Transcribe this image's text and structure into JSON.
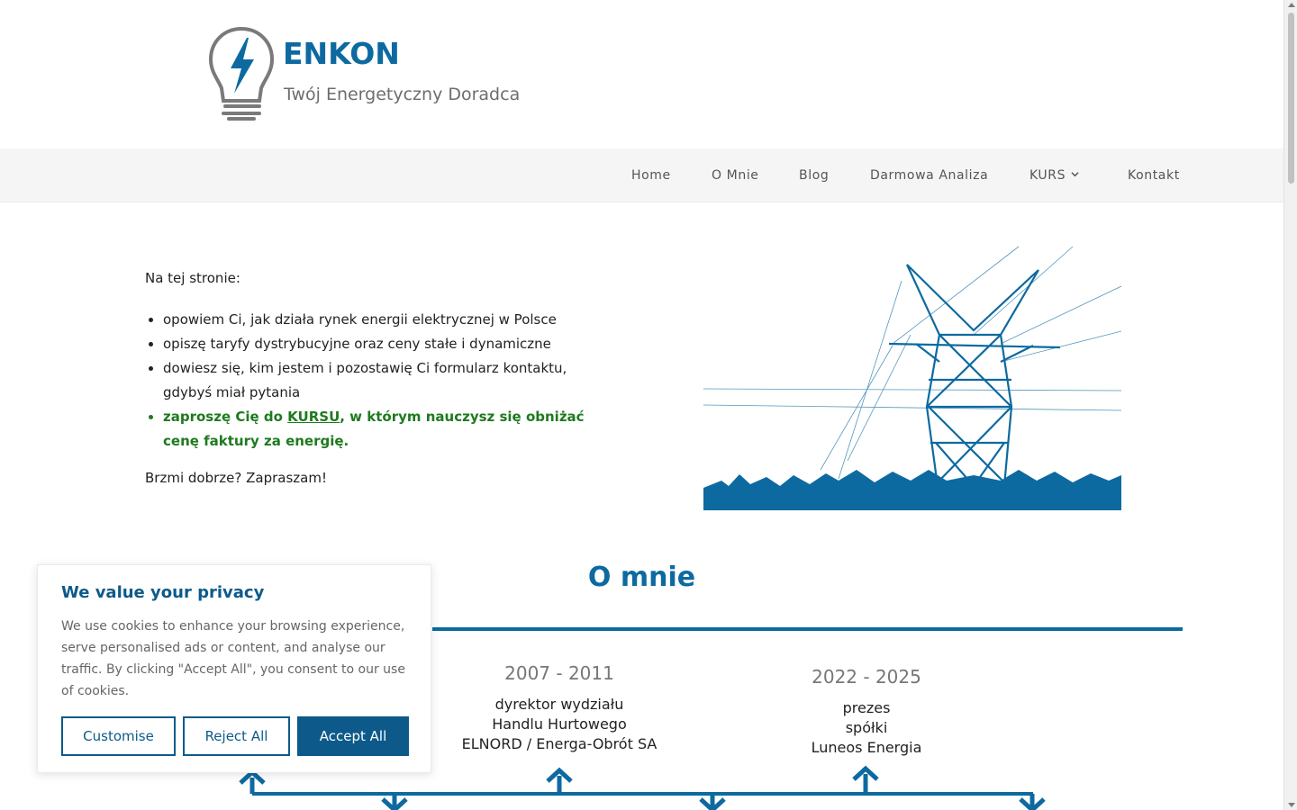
{
  "brand": {
    "name": "ENKON",
    "tagline": "Twój Energetyczny Doradca",
    "logo_icon": "lightbulb-bolt-icon",
    "accent_color": "#0d6aa0"
  },
  "nav": {
    "items": [
      {
        "label": "Home"
      },
      {
        "label": "O Mnie"
      },
      {
        "label": "Blog"
      },
      {
        "label": "Darmowa Analiza"
      },
      {
        "label": "KURS",
        "has_dropdown": true
      },
      {
        "label": "Kontakt"
      }
    ]
  },
  "intro": {
    "lead": "Na tej stronie:",
    "bullets": [
      "opowiem Ci, jak działa rynek energii elektrycznej w Polsce",
      "opiszę taryfy dystrybucyjne oraz ceny stałe i dynamiczne",
      "dowiesz się, kim jestem i pozostawię Ci formularz kontaktu, gdybyś miał pytania"
    ],
    "highlight": {
      "before": "zaproszę Cię do ",
      "link": "KURSU",
      "after": ", w którym nauczysz się obniżać cenę faktury za energię.",
      "color": "#1e7a1e"
    },
    "closing": "Brzmi dobrze?  Zapraszam!"
  },
  "about": {
    "title": "O mnie",
    "timeline": [
      {
        "years": "2007 - 2011",
        "lines": [
          "dyrektor wydziału",
          "Handlu Hurtowego",
          "ELNORD / Energa-Obrót SA"
        ]
      },
      {
        "years": "2022 - 2025",
        "lines": [
          "prezes",
          "spółki",
          "Luneos Energia"
        ]
      }
    ]
  },
  "cookie": {
    "title": "We value your privacy",
    "text": "We use cookies to enhance your browsing experience, serve personalised ads or content, and analyse our traffic. By clicking \"Accept All\", you consent to our use of cookies.",
    "customise": "Customise",
    "reject": "Reject All",
    "accept": "Accept All"
  }
}
